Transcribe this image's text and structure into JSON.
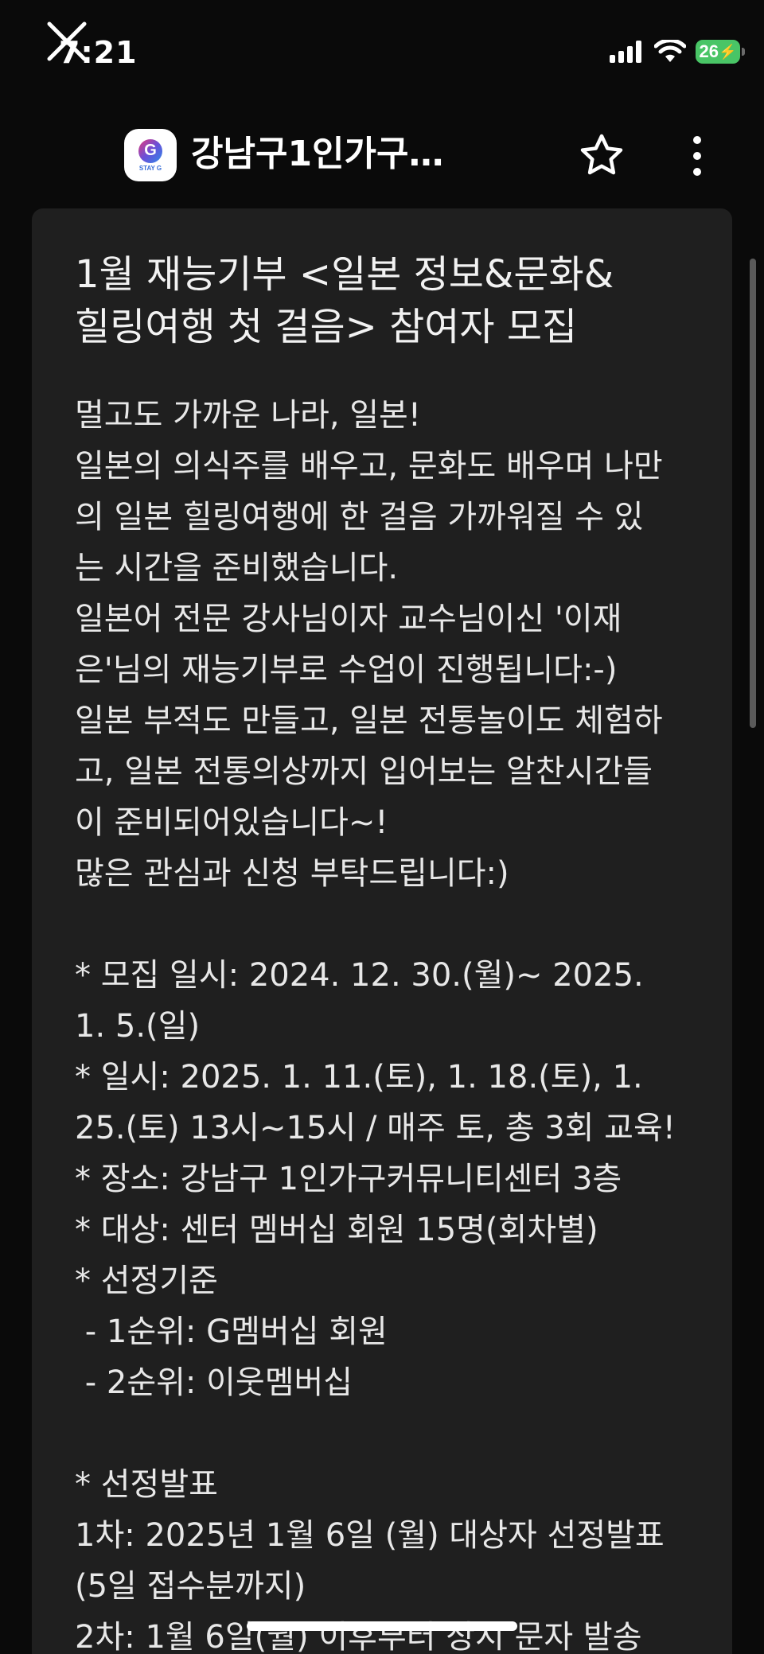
{
  "status_bar": {
    "time": "7:21",
    "battery": "26",
    "icons": [
      "cellular-signal-icon",
      "wifi-icon",
      "battery-charging-icon"
    ]
  },
  "app_bar": {
    "channel_title": "강남구1인가구…",
    "icons": [
      "close-icon",
      "channel-logo-icon",
      "star-icon",
      "more-vertical-icon"
    ]
  },
  "channel_logo": {
    "letter": "G",
    "subtext": "STAY G"
  },
  "post": {
    "title_lines": [
      "1월 재능기부 <일본 정보&문화&",
      "힐링여행 첫 걸음> 참여자 모집"
    ],
    "body_lines": [
      "멀고도 가까운 나라, 일본!",
      "일본의 의식주를 배우고, 문화도 배우며 나만",
      "의 일본 힐링여행에 한 걸음 가까워질 수 있",
      "는 시간을 준비했습니다.",
      "일본어 전문 강사님이자 교수님이신 '이재",
      "은'님의 재능기부로 수업이 진행됩니다:-)",
      "일본 부적도 만들고, 일본 전통놀이도 체험하",
      "고, 일본 전통의상까지 입어보는 알찬시간들",
      "이 준비되어있습니다~!",
      "많은 관심과 신청 부탁드립니다:)",
      "",
      "* 모집 일시:  2024. 12. 30.(월)~ 2025.",
      "1. 5.(일)",
      "* 일시:  2025. 1. 11.(토), 1. 18.(토), 1.",
      "25.(토) 13시~15시  / 매주 토, 총 3회 교육!",
      "* 장소: 강남구 1인가구커뮤니티센터 3층",
      "* 대상: 센터 멤버십 회원 15명(회차별)",
      "* 선정기준",
      " - 1순위: G멤버십 회원",
      " - 2순위: 이웃멤버십",
      "",
      "* 선정발표",
      "1차: 2025년 1월 6일 (월) 대상자 선정발표",
      "(5일 접수분까지)",
      "2차: 1월 6일(월) 이후부터 상시 문자 발송"
    ]
  },
  "colors": {
    "background": "#0a0a0a",
    "card": "#1f1f1f",
    "battery": "#49c566",
    "text": "#e8e8e8"
  }
}
